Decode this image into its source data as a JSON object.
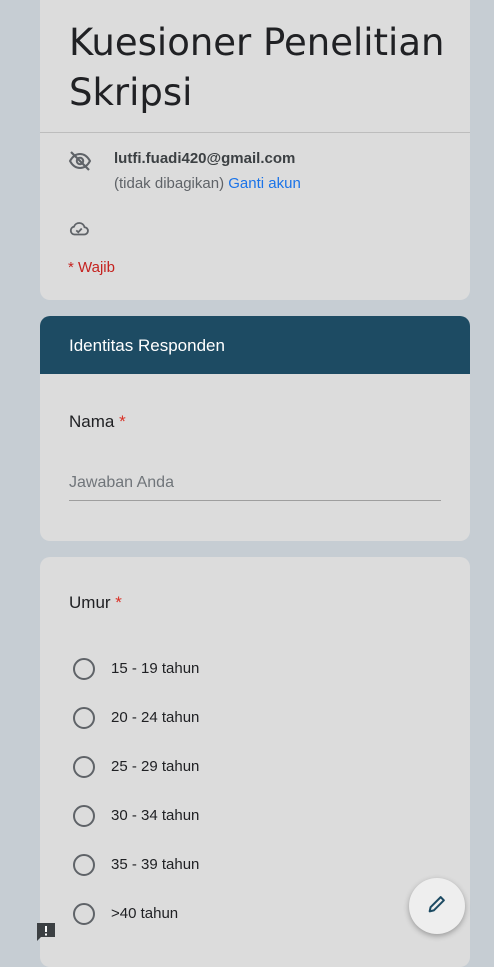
{
  "form": {
    "title": "Kuesioner Penelitian Skripsi",
    "account_email": "lutfi.fuadi420@gmail.com",
    "not_shared_text": "(tidak dibagikan)",
    "switch_account_label": "Ganti akun",
    "required_note": "* Wajib"
  },
  "section": {
    "title": "Identitas Responden"
  },
  "questions": {
    "name": {
      "label": "Nama",
      "required_mark": "*",
      "placeholder": "Jawaban Anda"
    },
    "age": {
      "label": "Umur",
      "required_mark": "*",
      "options": [
        "15 - 19 tahun",
        "20 - 24 tahun",
        "25 - 29 tahun",
        "30 - 34 tahun",
        "35 - 39 tahun",
        ">40 tahun"
      ]
    }
  },
  "icons": {
    "account": "eye-off-icon",
    "cloud": "cloud-check-icon",
    "edit": "pencil-icon",
    "feedback": "feedback-icon"
  },
  "colors": {
    "section_header": "#1d4b63",
    "link": "#1a73e8",
    "required": "#d93025",
    "background": "#c6cdd3",
    "card": "#dcdcdc"
  }
}
